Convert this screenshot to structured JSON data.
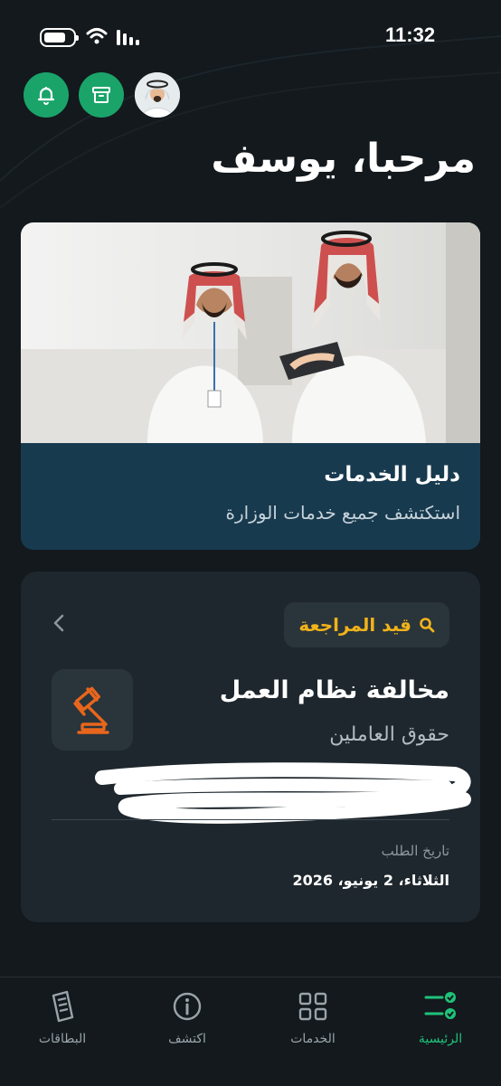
{
  "status_bar": {
    "time": "11:32"
  },
  "header": {
    "greeting": "مرحبا، يوسف"
  },
  "guide_card": {
    "title": "دليل الخدمات",
    "subtitle": "استكتشف جميع خدمات الوزارة"
  },
  "request_card": {
    "status": "قيد المراجعة",
    "title": "مخالفة نظام العمل",
    "subtitle": "حقوق العاملين",
    "date_label": "تاريخ الطلب",
    "date_value": "الثلاثاء، 2 يونيو، 2026"
  },
  "nav": {
    "home": "الرئيسية",
    "services": "الخدمات",
    "explore": "اكتشف",
    "cards": "البطاقات"
  },
  "colors": {
    "accent_green": "#1aa46a",
    "active_nav": "#1fc37a",
    "status_amber": "#f0b31a",
    "gavel_orange": "#e8661c",
    "card_blue": "#183a4f"
  },
  "icons": [
    "bell-icon",
    "archive-icon",
    "search-icon",
    "chevron-left-icon",
    "gavel-icon",
    "home-checklist-icon",
    "services-grid-icon",
    "info-icon",
    "cards-icon"
  ]
}
